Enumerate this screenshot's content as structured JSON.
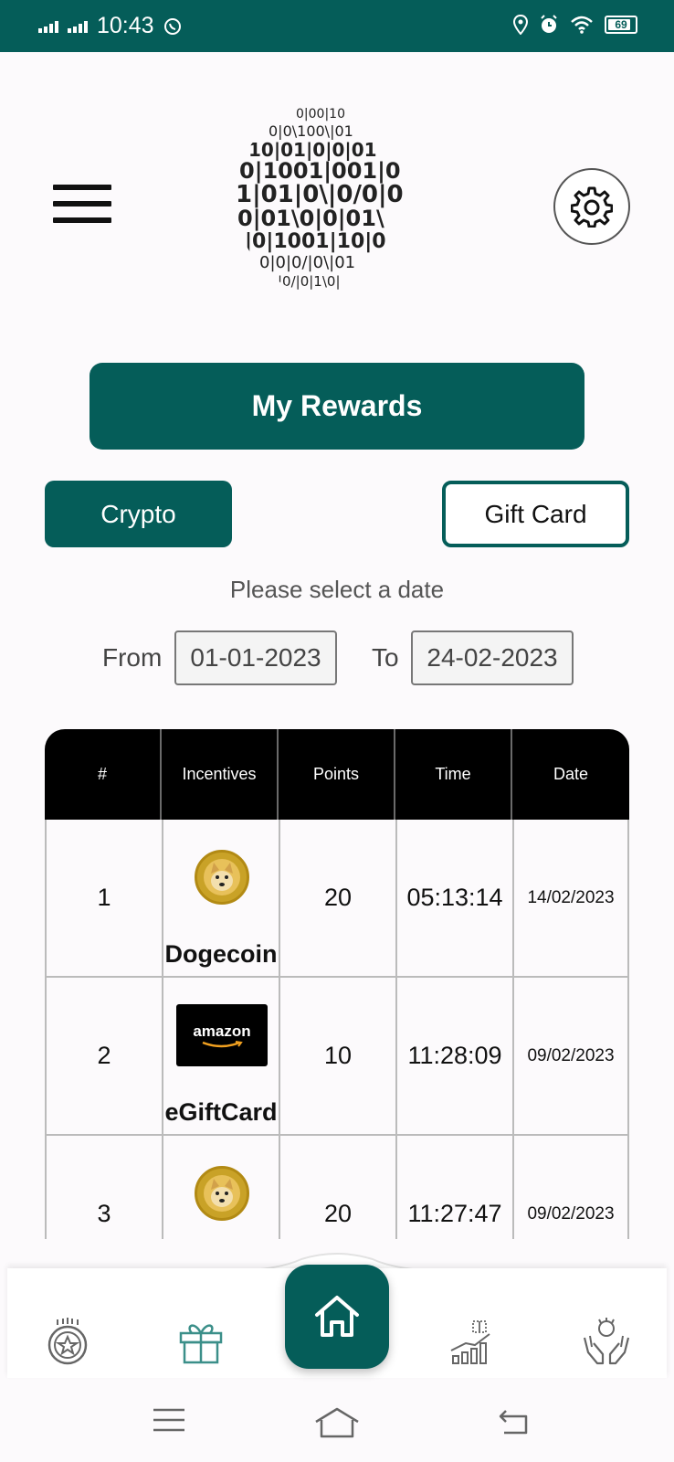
{
  "status_bar": {
    "time": "10:43",
    "battery": "69",
    "icons": [
      "signal-icon",
      "signal-icon",
      "whatsapp-icon",
      "location-icon",
      "alarm-icon",
      "wifi-icon",
      "battery-icon"
    ]
  },
  "header": {
    "menu_icon": "hamburger-icon",
    "logo": "binary-sphere-logo",
    "settings_icon": "gear-icon"
  },
  "title_button": "My Rewards",
  "tabs": {
    "crypto": "Crypto",
    "gift_card": "Gift Card"
  },
  "date_filter": {
    "prompt": "Please select a date",
    "from_label": "From",
    "from_value": "01-01-2023",
    "to_label": "To",
    "to_value": "24-02-2023"
  },
  "table": {
    "columns": [
      "#",
      "Incentives",
      "Points",
      "Time",
      "Date"
    ],
    "rows": [
      {
        "num": "1",
        "incentive": "Dogecoin",
        "icon": "dogecoin-icon",
        "points": "20",
        "time": "05:13:14",
        "date": "14/02/2023"
      },
      {
        "num": "2",
        "incentive": "eGiftCard",
        "icon": "amazon-icon",
        "icon_text": "amazon",
        "points": "10",
        "time": "11:28:09",
        "date": "09/02/2023"
      },
      {
        "num": "3",
        "incentive": "",
        "icon": "dogecoin-icon",
        "points": "20",
        "time": "11:27:47",
        "date": "09/02/2023"
      }
    ]
  },
  "bottom_nav": {
    "items": [
      "badge-icon",
      "gift-icon",
      "home-icon",
      "growth-chart-icon",
      "hands-icon"
    ]
  },
  "colors": {
    "primary": "#055d59",
    "header_bg": "#000000",
    "background": "#fcfafc"
  }
}
